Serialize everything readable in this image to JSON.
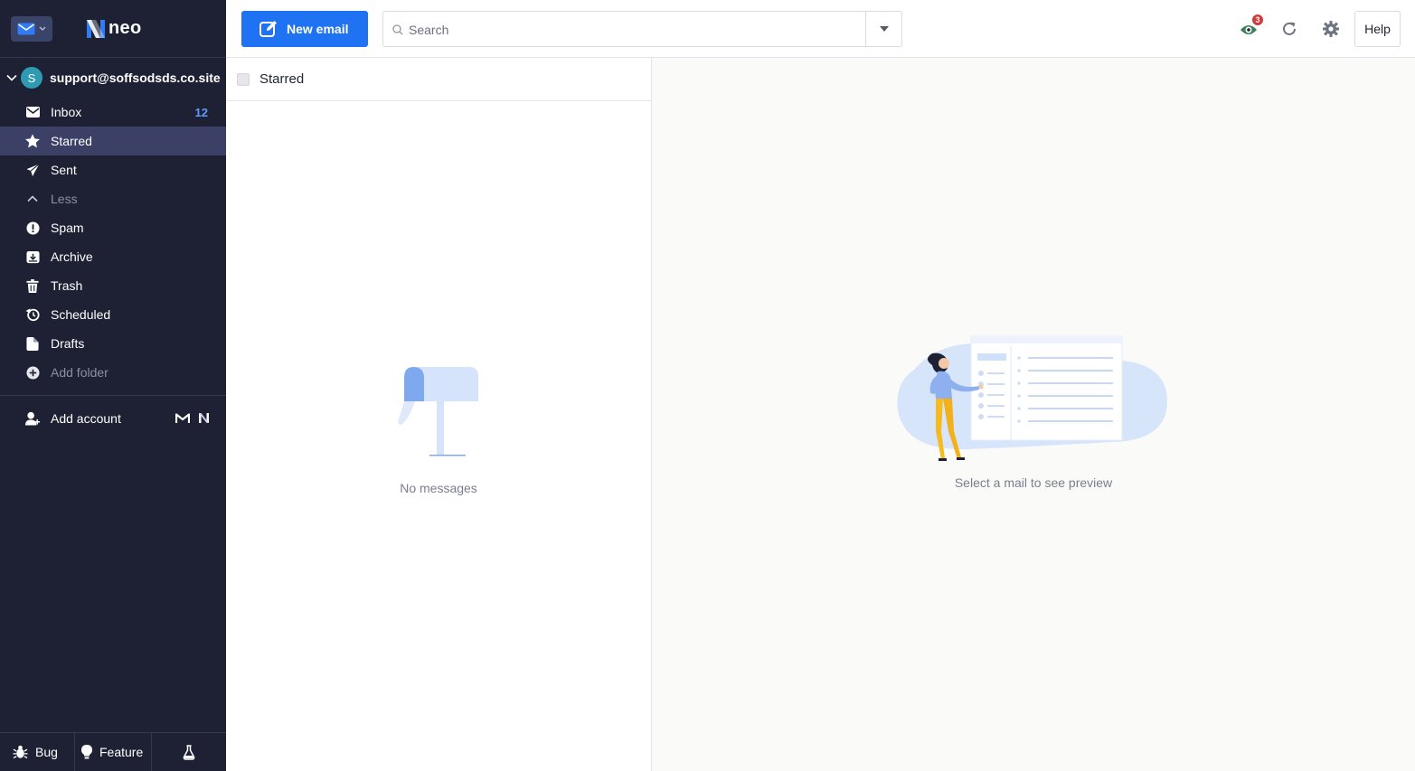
{
  "brand": {
    "name": "neo"
  },
  "account": {
    "initial": "S",
    "email": "support@soffsodsds.co.site"
  },
  "folders": [
    {
      "label": "Inbox",
      "icon": "envelope-icon",
      "count": "12"
    },
    {
      "label": "Starred",
      "icon": "star-icon",
      "active": true
    },
    {
      "label": "Sent",
      "icon": "paper-plane-icon"
    },
    {
      "label": "Less",
      "icon": "chevron-up-icon",
      "muted": true
    },
    {
      "label": "Spam",
      "icon": "exclamation-circle-icon"
    },
    {
      "label": "Archive",
      "icon": "archive-icon"
    },
    {
      "label": "Trash",
      "icon": "trash-icon"
    },
    {
      "label": "Scheduled",
      "icon": "clock-icon"
    },
    {
      "label": "Drafts",
      "icon": "draft-icon"
    },
    {
      "label": "Add folder",
      "icon": "plus-circle-icon",
      "muted": true
    }
  ],
  "add_account": {
    "label": "Add account"
  },
  "bottom": {
    "bug": "Bug",
    "feature": "Feature"
  },
  "toolbar": {
    "new_email": "New email",
    "search_placeholder": "Search",
    "notification_count": "3",
    "help": "Help"
  },
  "list": {
    "title": "Starred",
    "empty_text": "No messages"
  },
  "preview": {
    "empty_text": "Select a mail to see preview"
  },
  "colors": {
    "sidebar": "#1d2133",
    "active_folder": "#3c4067",
    "accent": "#1f72f2",
    "count": "#5d9cff"
  }
}
